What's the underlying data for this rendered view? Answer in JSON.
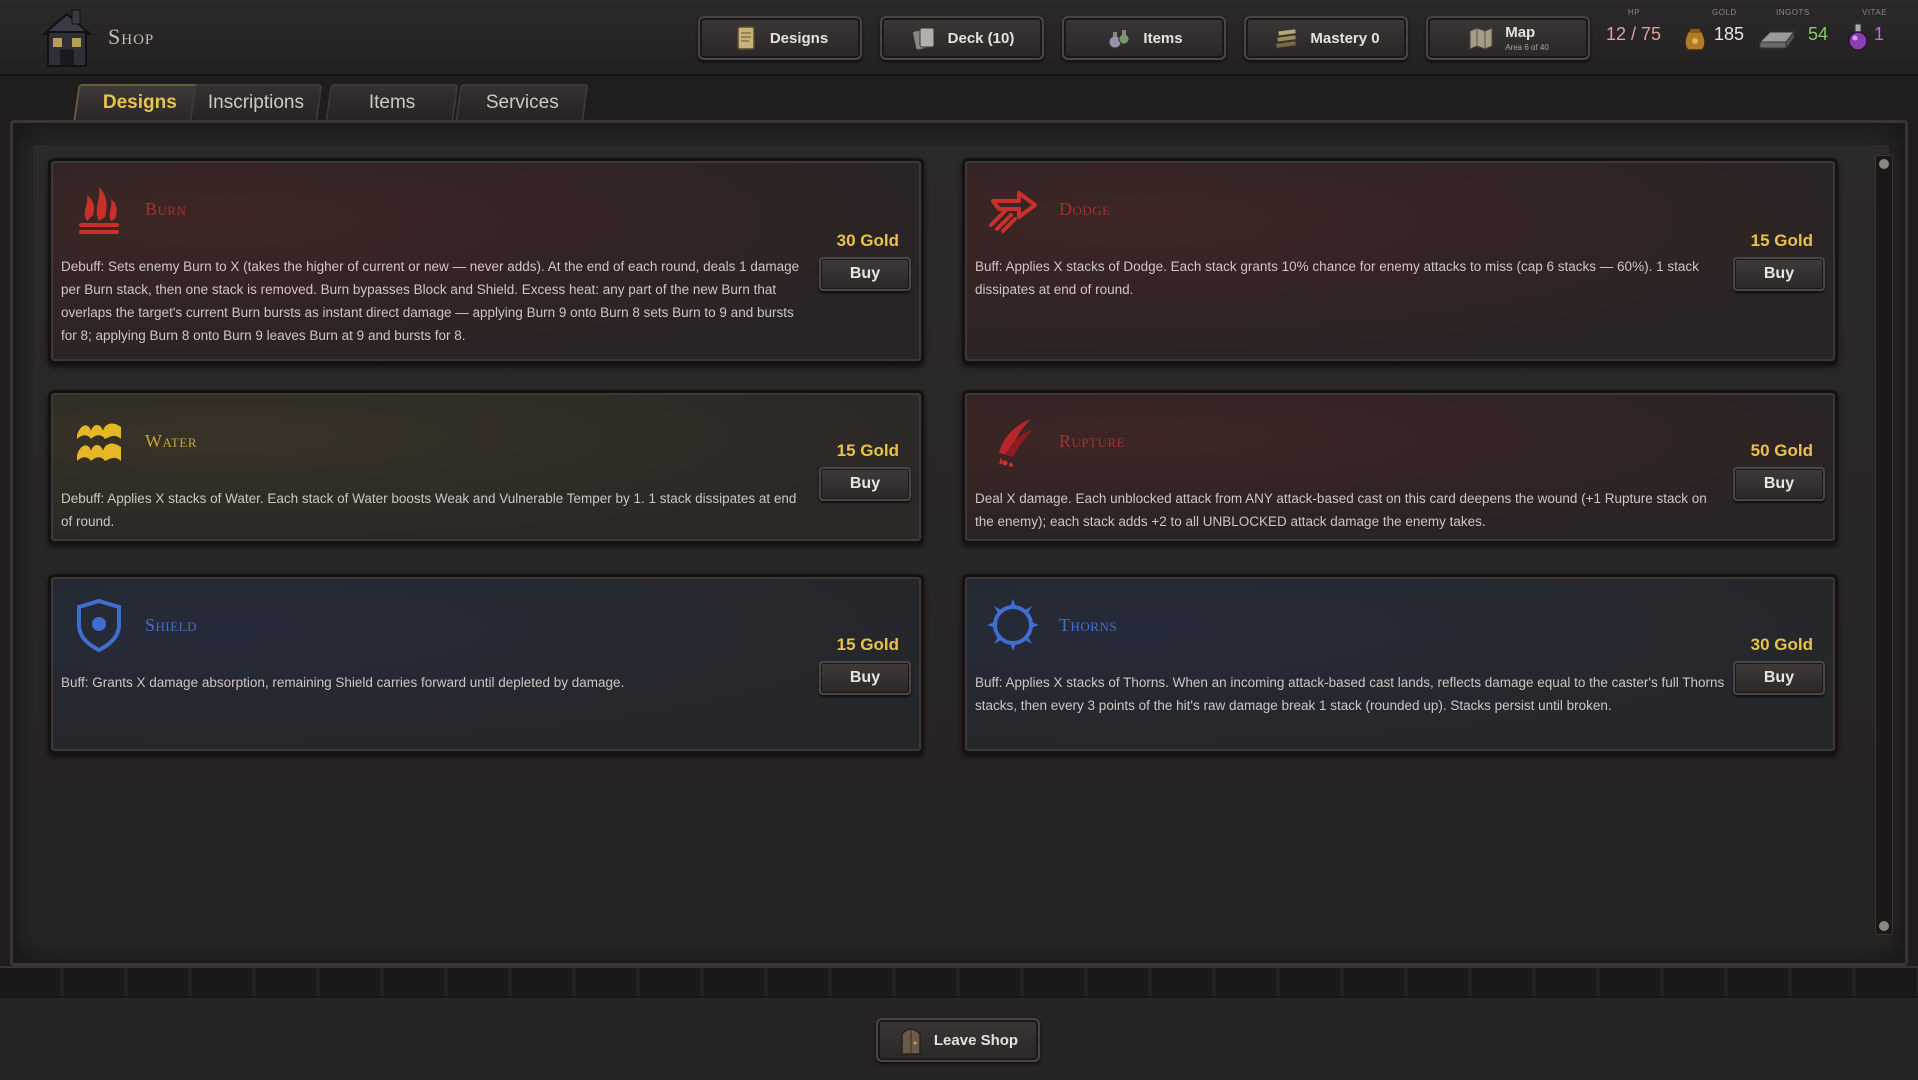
{
  "header": {
    "title": "Shop",
    "nav": [
      {
        "label": "Designs",
        "icon": "scroll-icon"
      },
      {
        "label": "Deck (10)",
        "icon": "cards-icon"
      },
      {
        "label": "Items",
        "icon": "potions-icon"
      },
      {
        "label": "Mastery 0",
        "icon": "book-stack-icon"
      },
      {
        "label": "Map",
        "sublabel": "Area 6 of 40",
        "icon": "map-icon"
      }
    ],
    "stats": {
      "hp": {
        "label": "HP",
        "value": "12 / 75",
        "color": "#e0a0a0"
      },
      "gold": {
        "label": "GOLD",
        "value": "185",
        "icon": "gold-pouch-icon"
      },
      "ingots": {
        "label": "INGOTS",
        "value": "54",
        "icon": "ingot-icon",
        "color": "#8cc96a"
      },
      "vitae": {
        "label": "VITAE",
        "value": "1",
        "icon": "vitae-potion-icon",
        "color": "#c06fd0"
      }
    }
  },
  "tabs": [
    {
      "label": "Designs",
      "active": true
    },
    {
      "label": "Inscriptions",
      "active": false
    },
    {
      "label": "Items",
      "active": false
    },
    {
      "label": "Services",
      "active": false
    }
  ],
  "cards": [
    {
      "title": "Burn",
      "title_color": "#a3322c",
      "icon": "flame-icon",
      "price": "30 Gold",
      "buy": "Buy",
      "desc": "Debuff: Sets enemy Burn to X (takes the higher of current or new — never adds). At the end of each round, deals 1 damage per Burn stack, then one stack is removed. Burn bypasses Block and Shield. Excess heat: any part of the new Burn that overlaps the target's current Burn bursts as instant direct damage — applying Burn 9 onto Burn 8 sets Burn to 9 and bursts for 8; applying Burn 8 onto Burn 9 leaves Burn at 9 and bursts for 8."
    },
    {
      "title": "Dodge",
      "title_color": "#a3322c",
      "icon": "dodge-arrow-icon",
      "price": "15 Gold",
      "buy": "Buy",
      "desc": "Buff: Applies X stacks of Dodge. Each stack grants 10% chance for enemy attacks to miss (cap 6 stacks — 60%). 1 stack dissipates at end of round."
    },
    {
      "title": "Water",
      "title_color": "#c9a33a",
      "icon": "waves-icon",
      "price": "15 Gold",
      "buy": "Buy",
      "desc": "Debuff: Applies X stacks of Water. Each stack of Water boosts Weak and Vulnerable Temper by 1. 1 stack dissipates at end of round."
    },
    {
      "title": "Rupture",
      "title_color": "#a3322c",
      "icon": "bleeding-claw-icon",
      "price": "50 Gold",
      "buy": "Buy",
      "desc": "Deal X damage. Each unblocked attack from ANY attack-based cast on this card deepens the wound (+1 Rupture stack on the enemy); each stack adds +2 to all UNBLOCKED attack damage the enemy takes."
    },
    {
      "title": "Shield",
      "title_color": "#3f6ed0",
      "icon": "shield-icon",
      "price": "15 Gold",
      "buy": "Buy",
      "desc": "Buff: Grants X damage absorption, remaining Shield carries forward until depleted by damage."
    },
    {
      "title": "Thorns",
      "title_color": "#3f6ed0",
      "icon": "thorn-ring-icon",
      "price": "30 Gold",
      "buy": "Buy",
      "desc": "Buff: Applies X stacks of Thorns. When an incoming attack-based cast lands, reflects damage equal to the caster's full Thorns stacks, then every 3 points of the hit's raw damage break 1 stack (rounded up). Stacks persist until broken."
    }
  ],
  "footer": {
    "leave_label": "Leave Shop",
    "icon": "door-icon"
  }
}
